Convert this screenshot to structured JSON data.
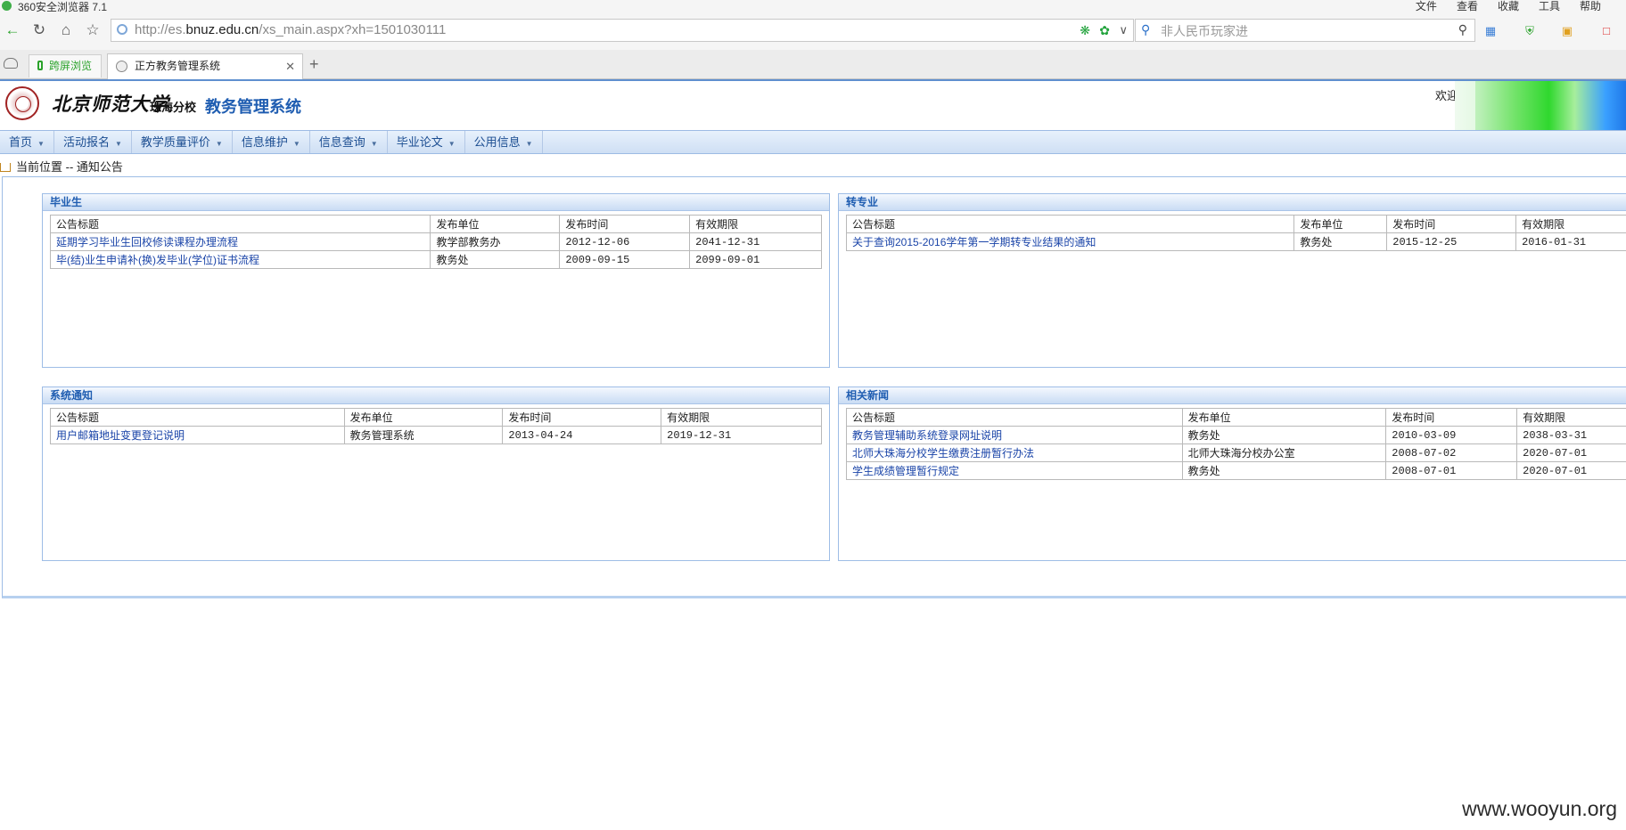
{
  "browser": {
    "title": "360安全浏览器 7.1",
    "menu": [
      "文件",
      "查看",
      "收藏",
      "工具",
      "帮助"
    ],
    "address_host_prefix": "http://es.",
    "address_host": "bnuz.edu.cn",
    "address_path": "/xs_main.aspx?xh=1501030111",
    "search_placeholder": "非人民币玩家进",
    "tabs": [
      {
        "label": "跨屏浏览"
      },
      {
        "label": "正方教务管理系统"
      }
    ]
  },
  "header": {
    "university_logo_text": "北京师范大学",
    "campus": "珠海分校",
    "system_title": "教务管理系统",
    "welcome": "欢迎"
  },
  "nav": [
    "首页",
    "活动报名",
    "教学质量评价",
    "信息维护",
    "信息查询",
    "毕业论文",
    "公用信息"
  ],
  "breadcrumb": "当前位置 -- 通知公告",
  "columns": {
    "title": "公告标题",
    "unit": "发布单位",
    "date": "发布时间",
    "expiry": "有效期限"
  },
  "panels": {
    "graduate": {
      "heading": "毕业生",
      "rows": [
        {
          "title": "延期学习毕业生回校修读课程办理流程",
          "unit": "教学部教务办",
          "date": "2012-12-06",
          "expiry": "2041-12-31"
        },
        {
          "title": "毕(结)业生申请补(换)发毕业(学位)证书流程",
          "unit": "教务处",
          "date": "2009-09-15",
          "expiry": "2099-09-01"
        }
      ]
    },
    "transfer": {
      "heading": "转专业",
      "rows": [
        {
          "title": "关于查询2015-2016学年第一学期转专业结果的通知",
          "unit": "教务处",
          "date": "2015-12-25",
          "expiry": "2016-01-31"
        }
      ]
    },
    "system": {
      "heading": "系统通知",
      "rows": [
        {
          "title": "用户邮箱地址变更登记说明",
          "unit": "教务管理系统",
          "date": "2013-04-24",
          "expiry": "2019-12-31"
        }
      ]
    },
    "news": {
      "heading": "相关新闻",
      "rows": [
        {
          "title": "教务管理辅助系统登录网址说明",
          "unit": "教务处",
          "date": "2010-03-09",
          "expiry": "2038-03-31"
        },
        {
          "title": "北师大珠海分校学生缴费注册暂行办法",
          "unit": "北师大珠海分校办公室",
          "date": "2008-07-02",
          "expiry": "2020-07-01"
        },
        {
          "title": "学生成绩管理暂行规定",
          "unit": "教务处",
          "date": "2008-07-01",
          "expiry": "2020-07-01"
        }
      ]
    }
  },
  "watermark": "www.wooyun.org"
}
